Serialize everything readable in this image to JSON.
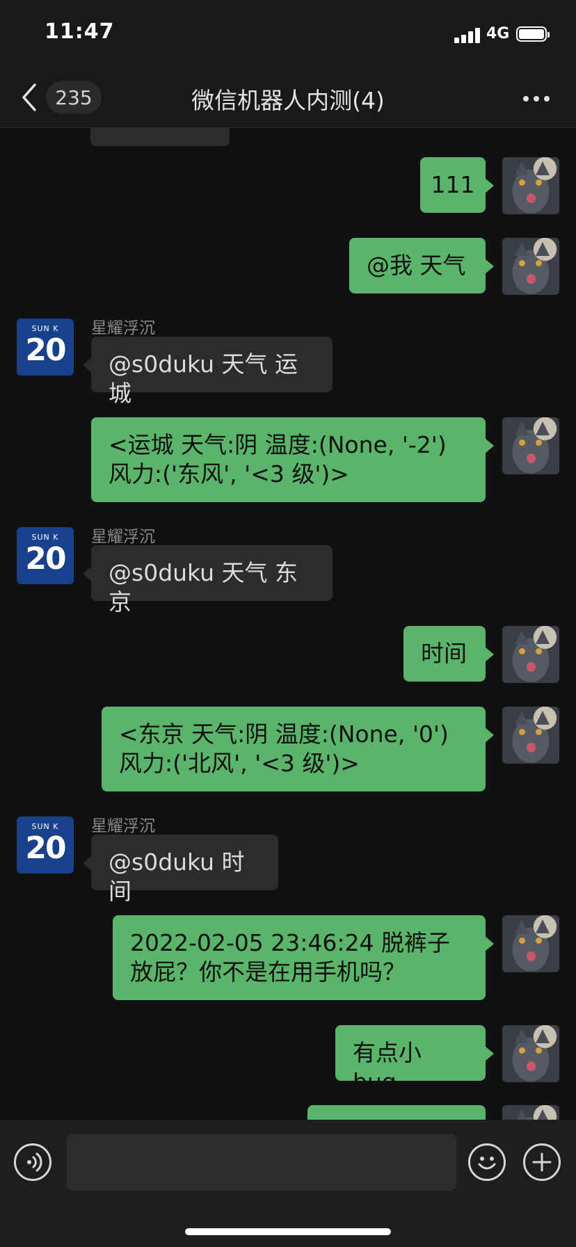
{
  "status_bar": {
    "time": "11:47",
    "network": "4G"
  },
  "header": {
    "unread_count": "235",
    "title": "微信机器人内测(4)"
  },
  "messages": [
    {
      "side": "me",
      "text": "111"
    },
    {
      "side": "me",
      "text": "@我 天气"
    },
    {
      "side": "them",
      "sender": "星耀浮沉",
      "text": "@s0duku 天气 运城"
    },
    {
      "side": "me",
      "text": "<运城 天气:阴 温度:(None, '-2') 风力:('东风', '<3 级')>"
    },
    {
      "side": "them",
      "sender": "星耀浮沉",
      "text": "@s0duku 天气 东京"
    },
    {
      "side": "me",
      "text": "时间"
    },
    {
      "side": "me",
      "text": "<东京 天气:阴 温度:(None, '0') 风力:('北风', '<3 级')>"
    },
    {
      "side": "them",
      "sender": "星耀浮沉",
      "text": "@s0duku 时间"
    },
    {
      "side": "me",
      "text": "2022-02-05 23:46:24 脱裤子放屁？你不是在用手机吗？"
    },
    {
      "side": "me",
      "text": "有点小 bug"
    }
  ],
  "other_avatar": {
    "name": "SUN K",
    "number": "20",
    "color": "#17418d"
  },
  "colors": {
    "my_bubble": "#5ab56a",
    "their_bubble": "#2c2c2c",
    "background": "#111111"
  },
  "icons": {
    "back": "chevron-left-icon",
    "more": "more-dots-icon",
    "voice": "voice-icon",
    "emoji": "emoji-icon",
    "plus": "plus-icon"
  }
}
